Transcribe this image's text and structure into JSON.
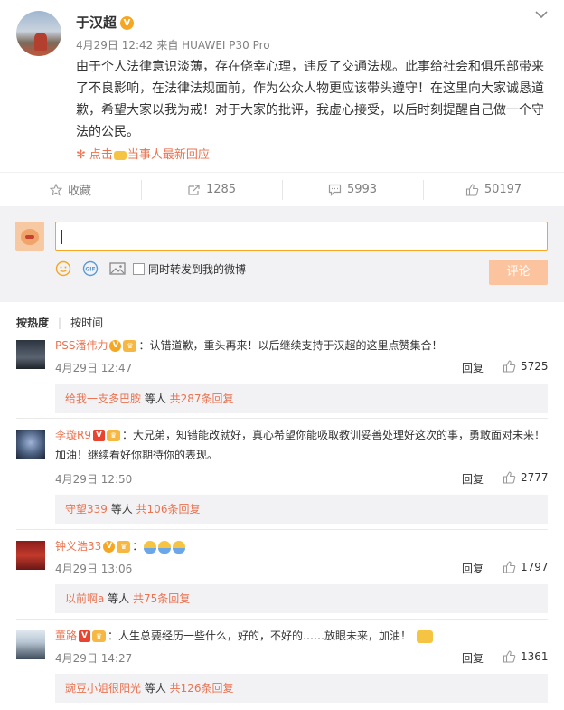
{
  "post": {
    "author": "于汉超",
    "date": "4月29日 12:42",
    "source": "来自 HUAWEI P30 Pro",
    "content": "由于个人法律意识淡薄，存在侥幸心理，违反了交通法规。此事给社会和俱乐部带来了不良影响，在法律法规面前，作为公众人物更应该带头遵守！在这里向大家诚恳道歉，希望大家以我为戒！对于大家的批评，我虚心接受，以后时刻提醒自己做一个守法的公民。",
    "follow_prefix": "点击",
    "follow_link": "当事人最新回应"
  },
  "actions": {
    "favorite": "收藏",
    "repost": "1285",
    "comments": "5993",
    "likes": "50197"
  },
  "compose": {
    "placeholder": "",
    "repost_label": "同时转发到我的微博",
    "submit_label": "评论"
  },
  "sort": {
    "hot": "按热度",
    "time": "按时间"
  },
  "comments": [
    {
      "name": "PSS潘伟力",
      "text": "：认错道歉，重头再来！以后继续支持于汉超的这里点赞集合！",
      "time": "4月29日 12:47",
      "reply": "回复",
      "likes": "5725",
      "sub_who": "给我一支多巴胺",
      "sub_mid": " 等人 ",
      "sub_count": "共287条回复"
    },
    {
      "name": "李璇R9",
      "text": "：大兄弟，知错能改就好，真心希望你能吸取教训妥善处理好这次的事，勇敢面对未来！加油！继续看好你期待你的表现。",
      "time": "4月29日 12:50",
      "reply": "回复",
      "likes": "2777",
      "sub_who": "守望339",
      "sub_mid": " 等人 ",
      "sub_count": "共106条回复"
    },
    {
      "name": "钟义浩33",
      "text": "：",
      "time": "4月29日 13:06",
      "reply": "回复",
      "likes": "1797",
      "sub_who": "以前啊a",
      "sub_mid": " 等人 ",
      "sub_count": "共75条回复"
    },
    {
      "name": "董路",
      "text": "：人生总要经历一些什么，好的，不好的……放眼未来，加油！",
      "time": "4月29日 14:27",
      "reply": "回复",
      "likes": "1361",
      "sub_who": "豌豆小姐很阳光",
      "sub_mid": " 等人 ",
      "sub_count": "共126条回复"
    }
  ],
  "colors": {
    "accent": "#eb7350",
    "vip": "#f5a623",
    "submit_bg": "#fcc39f",
    "panel_bg": "#f2f2f5"
  }
}
